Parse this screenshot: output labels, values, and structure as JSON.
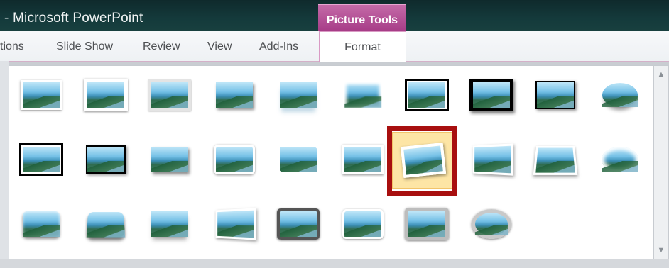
{
  "window": {
    "title": "- Microsoft PowerPoint",
    "contextual_tab_group": "Picture Tools"
  },
  "ribbon_tabs": [
    {
      "label": "tions"
    },
    {
      "label": "Slide Show"
    },
    {
      "label": "Review"
    },
    {
      "label": "View"
    },
    {
      "label": "Add-Ins"
    },
    {
      "label": "Format",
      "active": true
    }
  ],
  "gallery": {
    "selected_index": 16,
    "items": [
      {
        "style": "s-white"
      },
      {
        "style": "s-thick-white"
      },
      {
        "style": "s-gray"
      },
      {
        "style": "s-shadow"
      },
      {
        "style": "s-reflect"
      },
      {
        "style": "s-soft"
      },
      {
        "style": "s-black-white"
      },
      {
        "style": "s-black-heavy"
      },
      {
        "style": "s-black"
      },
      {
        "style": "s-oval"
      },
      {
        "style": "s-black-white"
      },
      {
        "style": "s-black"
      },
      {
        "style": "s-shadow"
      },
      {
        "style": "s-rounded-white"
      },
      {
        "style": "s-snip"
      },
      {
        "style": "s-white"
      },
      {
        "style": "s-rotated"
      },
      {
        "style": "s-persp"
      },
      {
        "style": "s-persp2"
      },
      {
        "style": "s-soft-oval"
      },
      {
        "style": "s-bevel"
      },
      {
        "style": "s-bevel-black"
      },
      {
        "style": "s-relaxed"
      },
      {
        "style": "s-persp"
      },
      {
        "style": "s-metal"
      },
      {
        "style": "s-rounded-white"
      },
      {
        "style": "s-metal-gray"
      },
      {
        "style": "s-metal-oval"
      }
    ]
  },
  "colors": {
    "title_bar": "#143a3b",
    "context_tab": "#a63b86",
    "selection_highlight": "#fde5a5",
    "selection_frame": "#a80f0f"
  },
  "icons": {
    "scroll_up": "triangle-up",
    "scroll_down": "triangle-down"
  }
}
